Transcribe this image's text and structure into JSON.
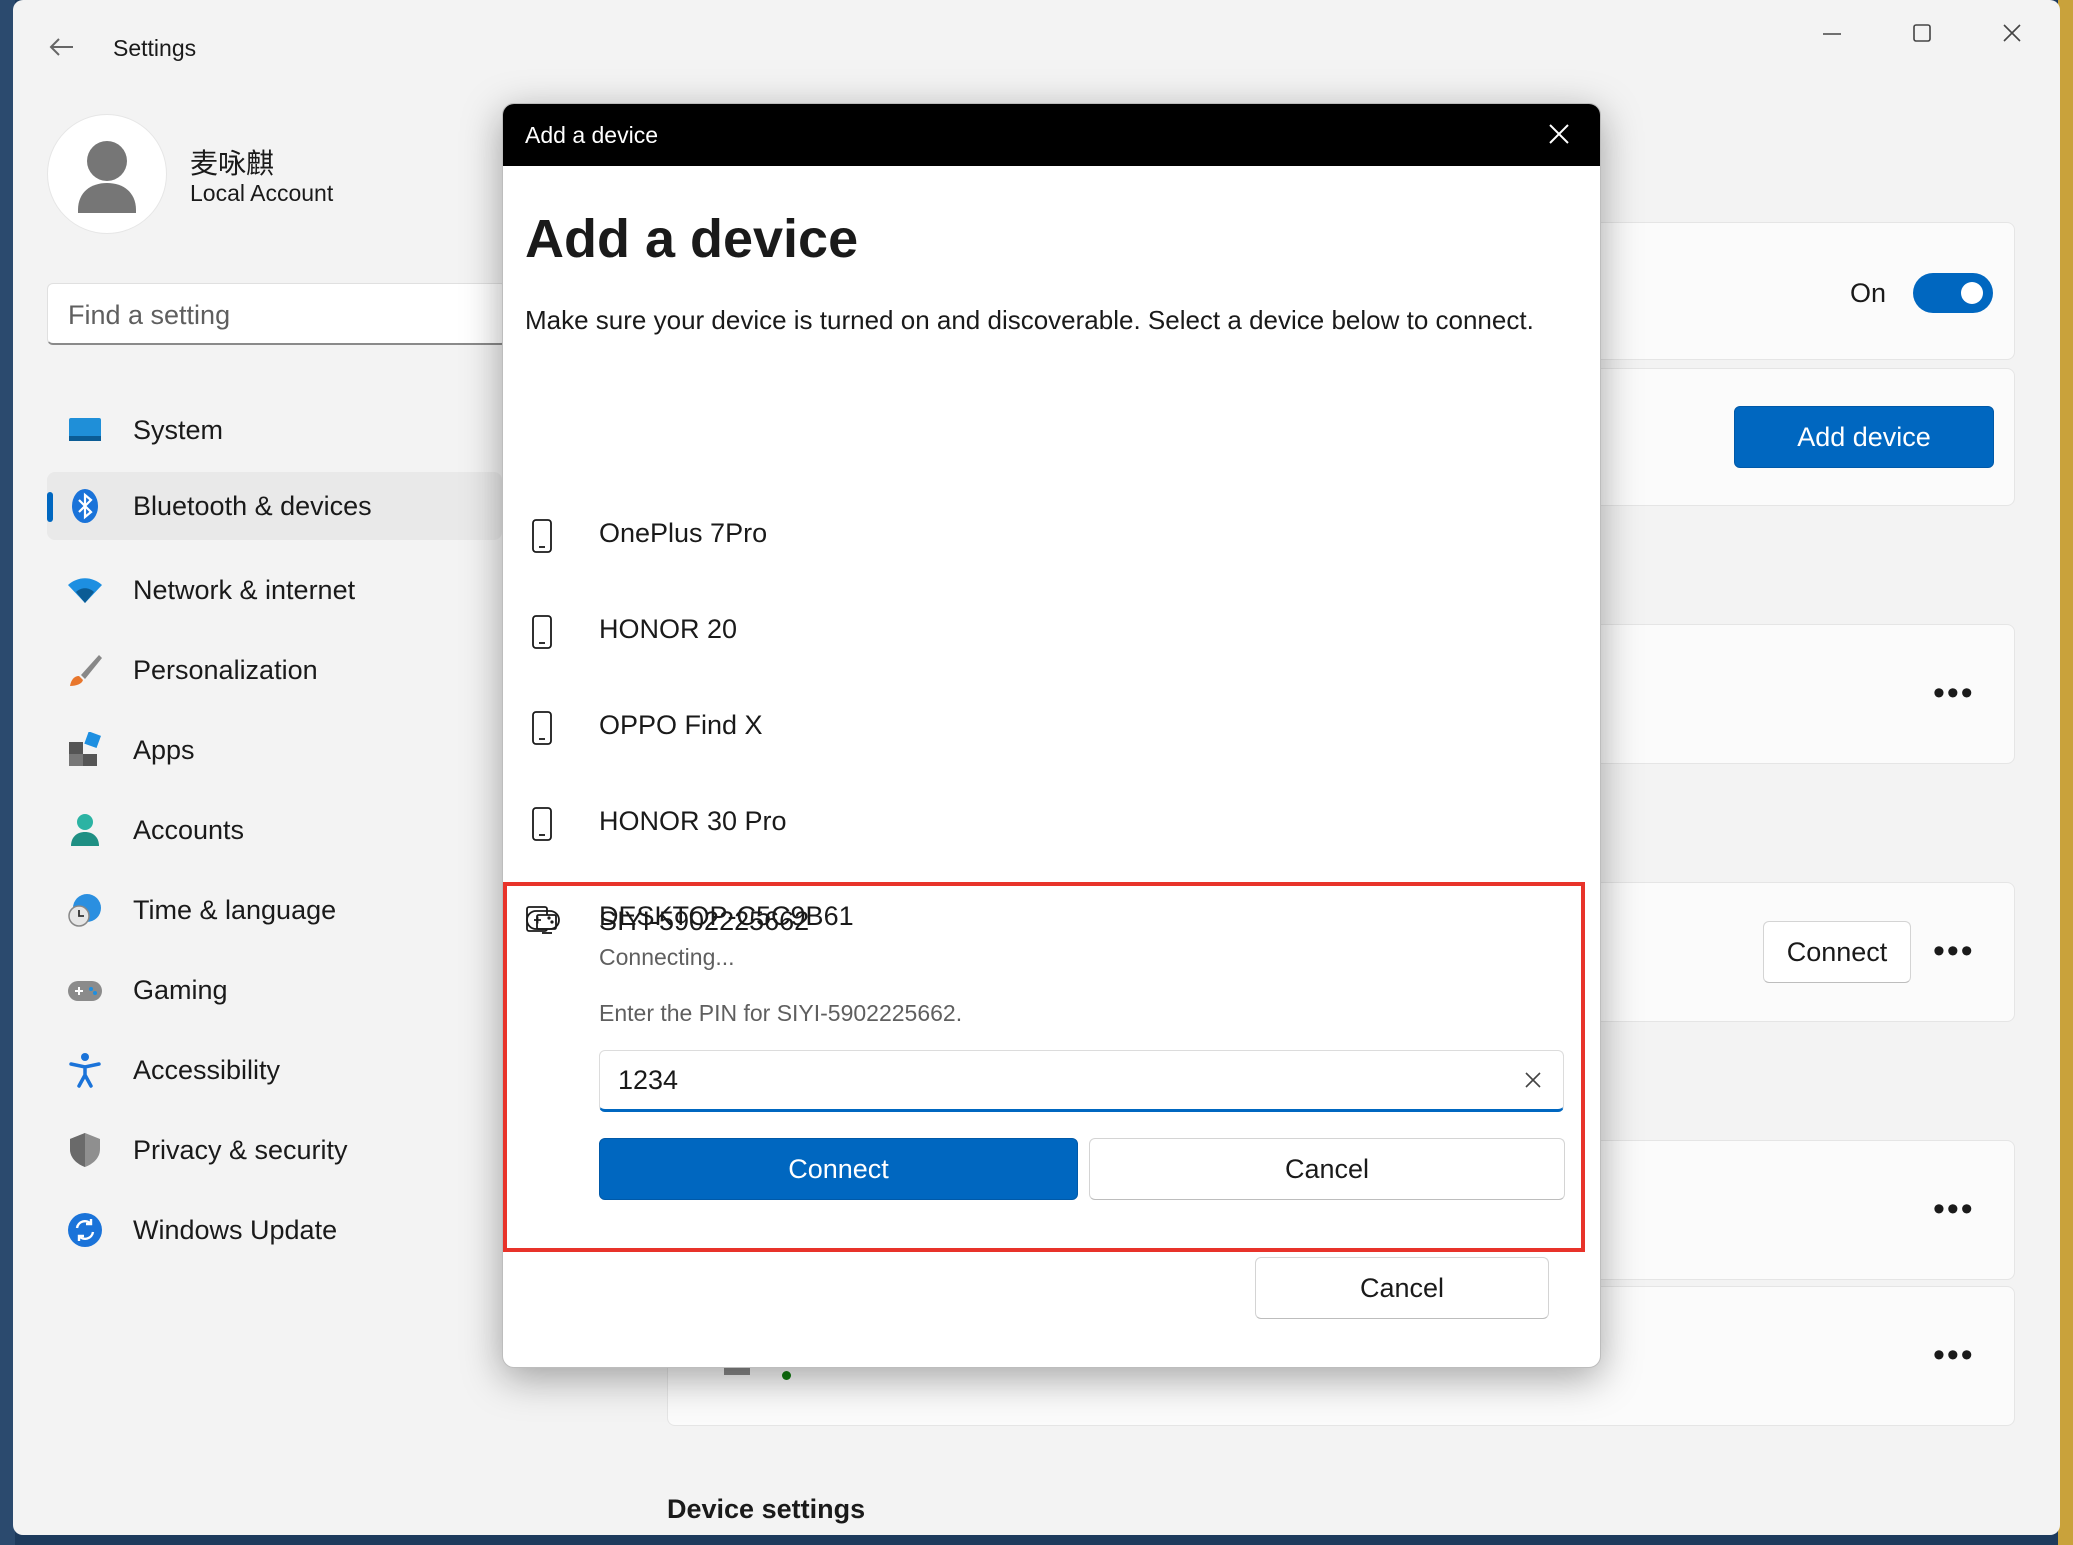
{
  "window": {
    "title": "Settings",
    "controls": {
      "minimize": "minimize-icon",
      "maximize": "maximize-icon",
      "close": "close-icon"
    }
  },
  "profile": {
    "name": "麦咏麒",
    "account_type": "Local Account"
  },
  "search": {
    "placeholder": "Find a setting"
  },
  "sidebar": {
    "items": [
      {
        "label": "System",
        "icon": "system-icon"
      },
      {
        "label": "Bluetooth & devices",
        "icon": "bluetooth-icon",
        "selected": true
      },
      {
        "label": "Network & internet",
        "icon": "wifi-icon"
      },
      {
        "label": "Personalization",
        "icon": "brush-icon"
      },
      {
        "label": "Apps",
        "icon": "apps-icon"
      },
      {
        "label": "Accounts",
        "icon": "accounts-icon"
      },
      {
        "label": "Time & language",
        "icon": "globe-clock-icon"
      },
      {
        "label": "Gaming",
        "icon": "gamepad-icon"
      },
      {
        "label": "Accessibility",
        "icon": "accessibility-icon"
      },
      {
        "label": "Privacy & security",
        "icon": "shield-icon"
      },
      {
        "label": "Windows Update",
        "icon": "update-icon"
      }
    ]
  },
  "main": {
    "bluetooth_toggle": {
      "state_label": "On",
      "on": true
    },
    "add_device_button": "Add device",
    "connect_button": "Connect",
    "more_label": "•••",
    "device_settings_heading": "Device settings"
  },
  "dialog": {
    "header_title": "Add a device",
    "heading": "Add a device",
    "description": "Make sure your device is turned on and discoverable. Select a device below to connect.",
    "devices": [
      {
        "name": "OnePlus 7Pro",
        "icon": "phone-icon"
      },
      {
        "name": "HONOR 20",
        "icon": "phone-icon"
      },
      {
        "name": "OPPO Find X",
        "icon": "phone-icon"
      },
      {
        "name": "HONOR 30 Pro",
        "icon": "phone-icon"
      },
      {
        "name": "DESKTOP-C5C9B61",
        "icon": "computer-icon"
      }
    ],
    "pairing": {
      "device_name": "SIYI-5902225662",
      "icon": "gamepad-icon",
      "status": "Connecting...",
      "pin_prompt": "Enter the PIN for SIYI-5902225662.",
      "pin_value": "1234",
      "connect_label": "Connect",
      "cancel_label": "Cancel",
      "highlight_color": "#e8332a"
    },
    "cancel_label": "Cancel"
  },
  "colors": {
    "accent": "#0067c0",
    "highlight": "#e8332a"
  }
}
